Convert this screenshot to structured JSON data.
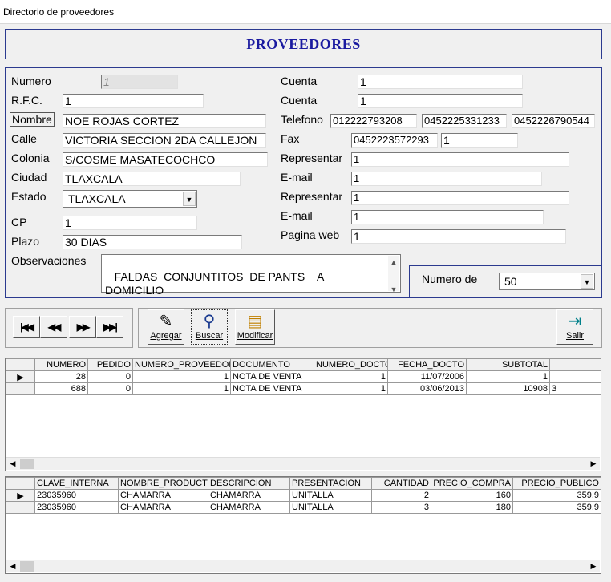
{
  "window": {
    "title": "Directorio de proveedores"
  },
  "header": {
    "title": "PROVEEDORES"
  },
  "form": {
    "numero_label": "Numero",
    "numero_value": "1",
    "rfc_label": "R.F.C.",
    "rfc_value": "1",
    "nombre_label": "Nombre",
    "nombre_value": "NOE ROJAS CORTEZ",
    "calle_label": "Calle",
    "calle_value": "VICTORIA SECCION 2DA CALLEJON",
    "colonia_label": "Colonia",
    "colonia_value": "S/COSME MASATECOCHCO",
    "ciudad_label": "Ciudad",
    "ciudad_value": "TLAXCALA",
    "estado_label": "Estado",
    "estado_value": "TLAXCALA",
    "cp_label": "CP",
    "cp_value": "1",
    "plazo_label": "Plazo",
    "plazo_value": "30 DIAS",
    "observaciones_label": "Observaciones",
    "observaciones_value": " FALDAS  CONJUNTITOS  DE PANTS    A\nDOMICILIO",
    "cuenta1_label": "Cuenta",
    "cuenta1_value": "1",
    "cuenta2_label": "Cuenta",
    "cuenta2_value": "1",
    "telefono_label": "Telefono",
    "telefono1": "012222793208",
    "telefono2": "0452225331233",
    "telefono3": "0452226790544",
    "fax_label": "Fax",
    "fax1": "0452223572293",
    "fax2": "1",
    "representar1_label": "Representar",
    "representar1_value": "1",
    "email1_label": "E-mail",
    "email1_value": "1",
    "representar2_label": "Representar",
    "representar2_value": "1",
    "email2_label": "E-mail",
    "email2_value": "1",
    "pagina_label": "Pagina web",
    "pagina_value": "1",
    "numero_de_label": "Numero de",
    "numero_de_value": "50"
  },
  "toolbar": {
    "agregar": "Agregar",
    "buscar": "Buscar",
    "modificar": "Modificar",
    "salir": "Salir"
  },
  "grid1": {
    "columns": [
      "NUMERO",
      "PEDIDO",
      "NUMERO_PROVEEDOR",
      "DOCUMENTO",
      "NUMERO_DOCTO",
      "FECHA_DOCTO",
      "SUBTOTAL"
    ],
    "rows": [
      [
        "28",
        "0",
        "1",
        "NOTA DE VENTA",
        "1",
        "11/07/2006",
        "1",
        ""
      ],
      [
        "688",
        "0",
        "1",
        "NOTA DE VENTA",
        "1",
        "03/06/2013",
        "10908",
        "3"
      ]
    ]
  },
  "grid2": {
    "columns": [
      "CLAVE_INTERNA",
      "NOMBRE_PRODUCTO",
      "DESCRIPCION",
      "PRESENTACION",
      "CANTIDAD",
      "PRECIO_COMPRA",
      "PRECIO_PUBLICO"
    ],
    "rows": [
      [
        "23035960",
        "CHAMARRA",
        "CHAMARRA",
        "UNITALLA",
        "2",
        "160",
        "359.9"
      ],
      [
        "23035960",
        "CHAMARRA",
        "CHAMARRA",
        "UNITALLA",
        "3",
        "180",
        "359.9"
      ]
    ]
  }
}
